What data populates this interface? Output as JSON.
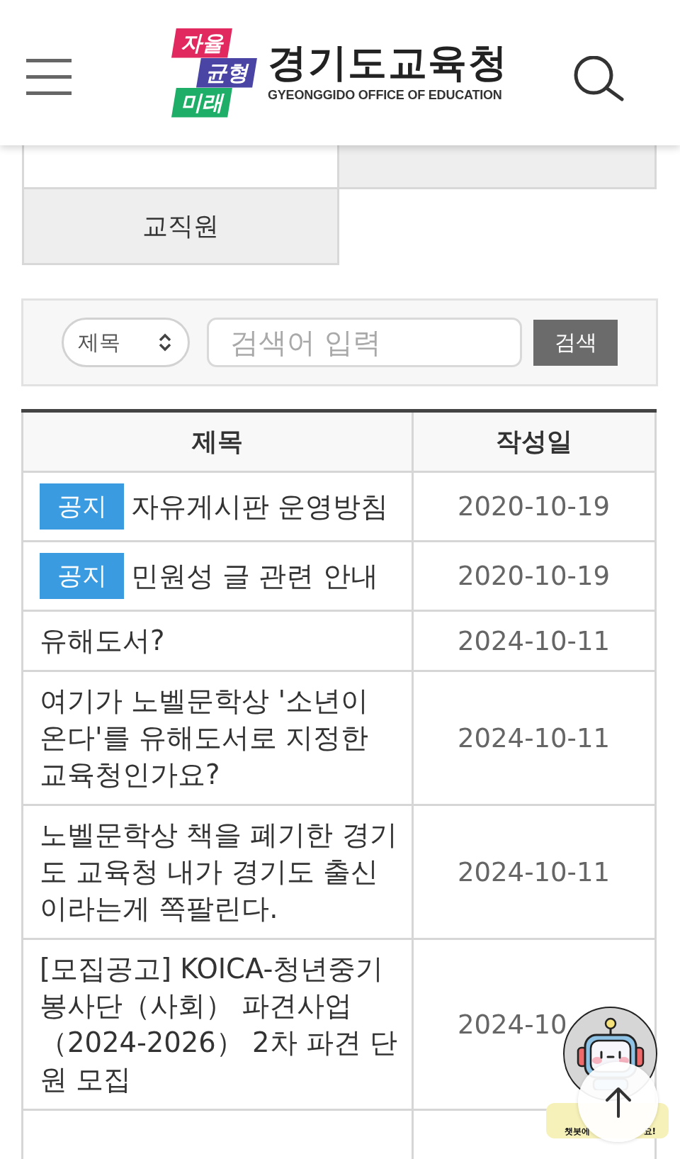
{
  "header": {
    "logo": {
      "slogan": [
        {
          "text": "자율",
          "color": "#e2295f"
        },
        {
          "text": "균형",
          "color": "#4a44a4"
        },
        {
          "text": "미래",
          "color": "#1fae68"
        }
      ],
      "name": "경기도교육청",
      "name_en": "GYEONGGIDO OFFICE OF EDUCATION"
    }
  },
  "tabs": [
    {
      "selected": true
    },
    {
      "selected": false
    },
    {
      "label": "교직원",
      "selected": false
    }
  ],
  "search": {
    "select": "제목",
    "placeholder": "검색어 입력",
    "button": "검색"
  },
  "table": {
    "columns": [
      "제목",
      "작성일"
    ],
    "rows": [
      {
        "badge": "공지",
        "title": "자유게시판 운영방침",
        "date": "2020-10-19"
      },
      {
        "badge": "공지",
        "title": "민원성 글 관련 안내",
        "date": "2020-10-19"
      },
      {
        "title": "유해도서?",
        "date": "2024-10-11"
      },
      {
        "title": "여기가 노벨문학상 '소년이 온다'를 유해도서로 지정한 교육청인가요?",
        "date": "2024-10-11"
      },
      {
        "title": "노벨문학상 책을 폐기한 경기도 교육청 내가 경기도 출신이라는게 쪽팔린다.",
        "date": "2024-10-11"
      },
      {
        "title": "[모집공고] KOICA-청년중기봉사단（사회） 파견사업（2024-2026） 2차 파견 단원 모집",
        "date": "2024-10"
      }
    ]
  },
  "chatbot": {
    "bubble_texts": [
      "챗봇에",
      "요!"
    ]
  }
}
